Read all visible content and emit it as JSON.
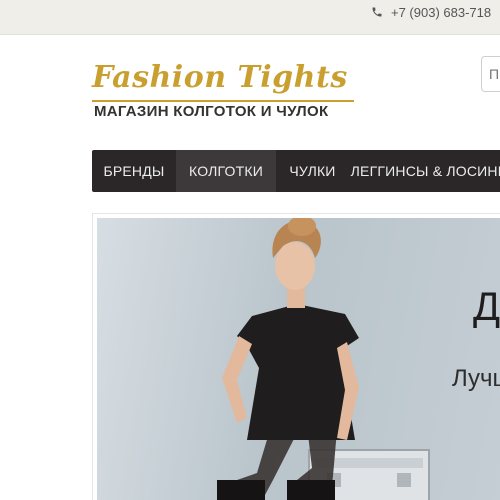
{
  "topbar": {
    "phone": "+7 (903) 683-718"
  },
  "logo": {
    "script": "Fashion Tights",
    "subtitle": "МАГАЗИН КОЛГОТОК И ЧУЛОК"
  },
  "nav": {
    "items": [
      {
        "label": "БРЕНДЫ"
      },
      {
        "label": "КОЛГОТКИ"
      },
      {
        "label": "ЧУЛКИ"
      },
      {
        "label": "ЛЕГГИНСЫ & ЛОСИНЫ"
      }
    ],
    "active_index": 1
  },
  "search": {
    "placeholder": "П"
  },
  "banner": {
    "heading": "До",
    "subheading": "Лучш"
  },
  "colors": {
    "gold": "#c9a030",
    "nav_bg": "#2b2728",
    "nav_active": "#3d393a",
    "topbar_bg": "#efeee9"
  }
}
